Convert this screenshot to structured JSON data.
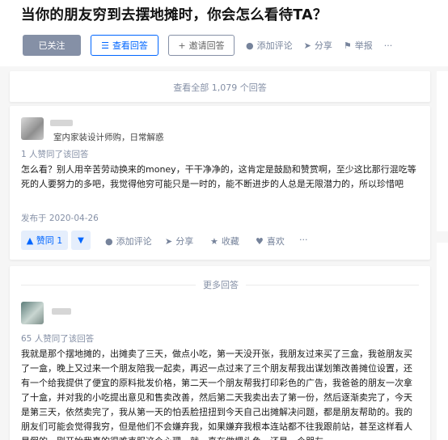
{
  "question": {
    "title": "当你的朋友穷到去摆地摊时，你会怎么看待TA？",
    "actions": {
      "followed": "已关注",
      "view_answers": "查看回答",
      "invite": "邀请回答",
      "comment": "添加评论",
      "share": "分享",
      "report": "举报",
      "more": "···"
    }
  },
  "view_all": "查看全部 1,079 个回答",
  "answer1": {
    "headline": "室内家装设计师购，日常解惑",
    "voters": "1 人赞同了该回答",
    "content": "怎么看？别人用辛苦劳动换来的money，干干净净的，这肯定是鼓励和赞赏啊，至少这比那行混吃等死的人要努力的多吧，我觉得他穷可能只是一时的，能不断进步的人总是无限潜力的，所以珍惜吧",
    "date": "发布于 2020-04-26",
    "vote_up": "▲ 赞同 1",
    "vote_down": "▼",
    "comment": "添加评论",
    "share": "分享",
    "collect": "收藏",
    "like": "喜欢",
    "more": "···"
  },
  "more_answers_label": "更多回答",
  "answer2": {
    "voters": "65 人赞同了该回答",
    "content": "我就是那个摆地摊的，出摊卖了三天，做点小吃，第一天没开张，我朋友过来买了三盒，我爸朋友买了一盒，晚上又过来一个朋友陪我一起卖，再迟一点过来了三个朋友帮我出谋划策改善摊位设置，还有一个给我提供了便宜的原料批发价格，第二天一个朋友帮我打印彩色的广告，我爸爸的朋友一次拿了十盒，并对我的小吃提出意见和售卖改善，然后第二天我卖出去了第一份，然后逐渐卖完了，今天是第三天，依然卖完了，我从第一天的怕丢脸扭扭到今天自己出摊解决问题，都是朋友帮助的。我的朋友们可能会觉得我穷，但是他们不会嫌弃我，如果嫌弃我根本连站都不往我跟前站，甚至这样看人是假的，刚开始我真的很难克服这个心理，就一直在做埋头鱼，还是一个朋友"
  },
  "icons": {
    "view": "list-pen-icon",
    "invite": "add-person-icon",
    "comment": "speech-bubble-icon",
    "share": "paper-plane-icon",
    "report": "flag-icon",
    "collect": "star-icon",
    "like": "heart-icon"
  },
  "colors": {
    "brand_blue": "#0066ff",
    "muted": "#8590a6",
    "follow_bg": "#8590a6",
    "vote_bg": "#e5eefc"
  }
}
